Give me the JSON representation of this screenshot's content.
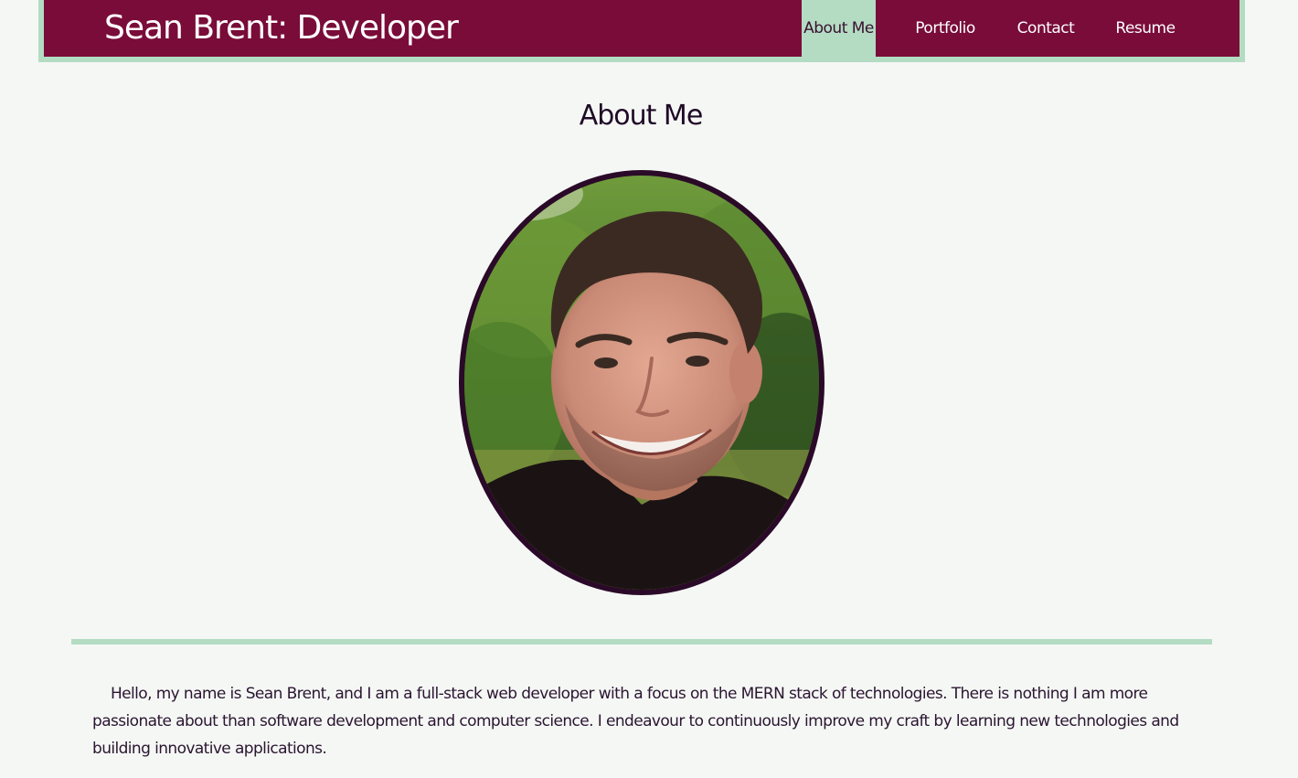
{
  "header": {
    "title": "Sean Brent: Developer"
  },
  "nav": {
    "items": [
      {
        "label": "About Me",
        "active": true
      },
      {
        "label": "Portfolio",
        "active": false
      },
      {
        "label": "Contact",
        "active": false
      },
      {
        "label": "Resume",
        "active": false
      }
    ]
  },
  "main": {
    "heading": "About Me",
    "photo_alt": "portrait-photo",
    "bio": "Hello, my name is Sean Brent, and I am a full-stack web developer with a focus on the MERN stack of technologies. There is nothing I am more passionate about than software development and computer science. I endeavour to continuously improve my craft by learning new technologies and building innovative applications."
  },
  "colors": {
    "header_bar": "#790c39",
    "accent_mint": "#b3dcc3",
    "page_background": "#f5f7f5",
    "text_dark": "#1f0a26",
    "photo_border": "#2a0a28"
  }
}
